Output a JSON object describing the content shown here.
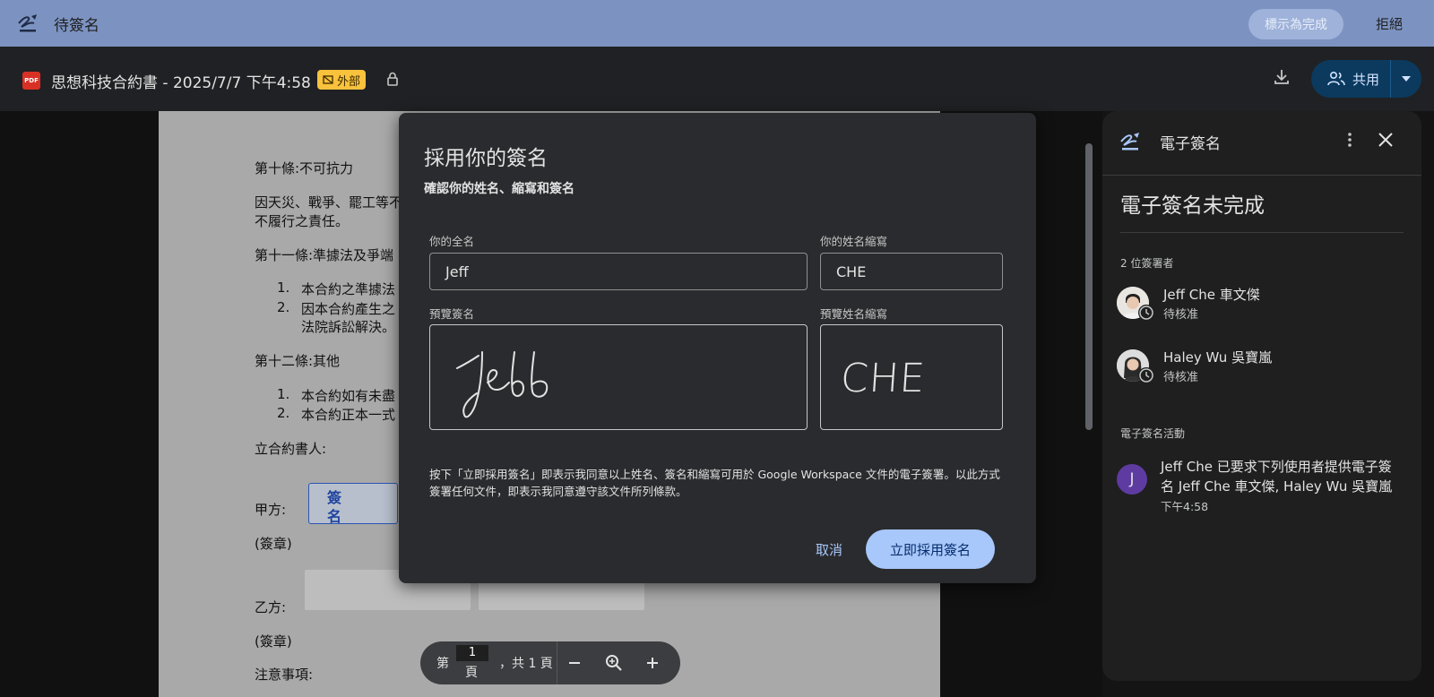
{
  "topbar": {
    "title": "待簽名",
    "mark_done": "標示為完成",
    "reject": "拒絕"
  },
  "docbar": {
    "pdf_label": "PDF",
    "title": "思想科技合約書 - 2025/7/7 下午4:58",
    "external_badge": "外部",
    "share": "共用"
  },
  "document": {
    "lines": [
      "第十條:不可抗力",
      "因天災、戰爭、罷工等不",
      "不履行之責任。",
      "第十一條:準據法及爭端",
      "1.",
      "本合約之準據法",
      "2.",
      "因本合約產生之",
      "法院訴訟解決。",
      "第十二條:其他",
      "1.",
      "本合約如有未盡",
      "2.",
      "本合約正本一式",
      "立合約書人:",
      "甲方:",
      "(簽章)",
      "乙方:",
      "(簽章)",
      "注意事項:"
    ],
    "sig_box_line1": "簽",
    "sig_box_line2": "名"
  },
  "pagenav": {
    "label_prefix": "第",
    "page_input": "1",
    "label_page": "頁",
    "total": "，共 1 頁"
  },
  "modal": {
    "title": "採用你的簽名",
    "subtitle": "確認你的姓名、縮寫和簽名",
    "fullname_label": "你的全名",
    "fullname_value": "Jeff",
    "initials_label": "你的姓名縮寫",
    "initials_value": "CHE",
    "preview_sig_label": "預覽簽名",
    "preview_initials_label": "預覽姓名縮寫",
    "preview_initials_text": "CHE",
    "consent": "按下「立即採用簽名」即表示我同意以上姓名、簽名和縮寫可用於 Google Workspace 文件的電子簽署。以此方式簽署任何文件，即表示我同意遵守該文件所列條款。",
    "cancel": "取消",
    "adopt": "立即採用簽名"
  },
  "panel": {
    "title": "電子簽名",
    "status": "電子簽名未完成",
    "signers_heading": "2 位簽署者",
    "signers": [
      {
        "name": "Jeff Che 車文傑",
        "state": "待核准"
      },
      {
        "name": "Haley Wu 吳寶嵐",
        "state": "待核准"
      }
    ],
    "activity_heading": "電子簽名活動",
    "activity": {
      "avatar_letter": "J",
      "text": "Jeff Che 已要求下列使用者提供電子簽名 Jeff Che 車文傑, Haley Wu 吳寶嵐",
      "time": "下午4:58"
    }
  },
  "colors": {
    "banner": "#7c93c2",
    "accent": "#a8c7fa",
    "share_bg": "#0b3a5e",
    "badge": "#f9c23c"
  },
  "icons": [
    "signature-icon",
    "pdf-icon",
    "external-icon",
    "lock-icon",
    "download-icon",
    "people-icon",
    "caret-down-icon",
    "minus-icon",
    "zoom-in-icon",
    "plus-icon",
    "more-vert-icon",
    "close-icon",
    "clock-icon"
  ]
}
